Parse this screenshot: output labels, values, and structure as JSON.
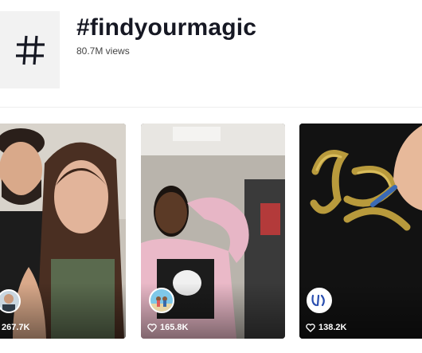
{
  "tag": {
    "icon": "hash-icon",
    "title": "#findyourmagic",
    "views": "80.7M views"
  },
  "videos": [
    {
      "likes": "267.7K",
      "like_icon": "heart-icon"
    },
    {
      "likes": "165.8K",
      "like_icon": "heart-icon"
    },
    {
      "likes": "138.2K",
      "like_icon": "heart-icon"
    }
  ],
  "colors": {
    "title": "#161823",
    "tile_bg": "#f2f2f2",
    "divider": "#eeeeee"
  }
}
